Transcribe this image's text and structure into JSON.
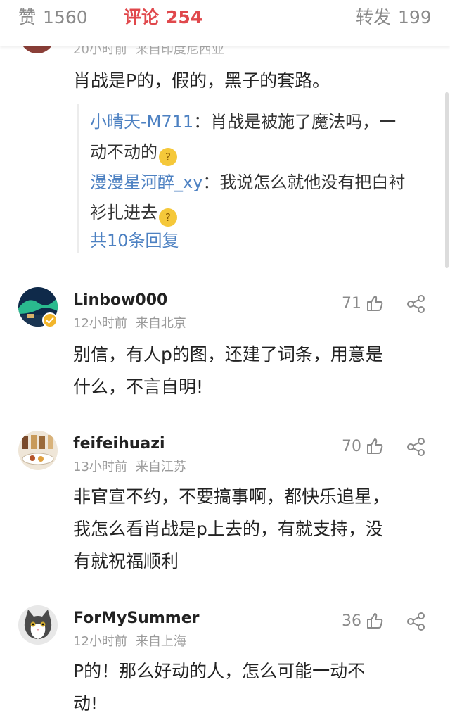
{
  "tabs": {
    "like": {
      "label": "赞",
      "count": "1560"
    },
    "comment": {
      "label": "评论",
      "count": "254"
    },
    "repost": {
      "label": "转发",
      "count": "199"
    }
  },
  "partial_comment": {
    "time": "20小时前",
    "source": "来自印度尼西亚",
    "text": "肖战是P的，假的，黑子的套路。",
    "replies": [
      {
        "user": "小晴天-M711",
        "sep": "：",
        "text_line1": "肖战是被施了魔法吗，一",
        "text_line2": "动不动的",
        "emoji": "thinking-emoji"
      },
      {
        "user": "漫漫星河醉_xy",
        "sep": "：",
        "text_line1": "我说怎么就他没有把白衬",
        "text_line2": "衫扎进去",
        "emoji": "laughing-emoji"
      }
    ],
    "more_replies": "共10条回复"
  },
  "comments": [
    {
      "user": "Linbow000",
      "time": "12小时前",
      "source": "来自北京",
      "likes": "71",
      "line1": "别信，有人p的图，还建了词条，用意是",
      "line2": "什么，不言自明!",
      "line3": ""
    },
    {
      "user": "feifeihuazi",
      "time": "13小时前",
      "source": "来自江苏",
      "likes": "70",
      "line1": "非官宣不约，不要搞事啊，都快乐追星，",
      "line2": "我怎么看肖战是p上去的，有就支持，没",
      "line3": "有就祝福顺利"
    },
    {
      "user": "ForMySummer",
      "time": "12小时前",
      "source": "来自上海",
      "likes": "36",
      "line1": "P的！那么好动的人，怎么可能一动不",
      "line2": "动!",
      "line3": ""
    }
  ],
  "icons": {
    "like": "thumbs-up-icon",
    "share": "share-icon"
  },
  "colors": {
    "accent": "#e0484c",
    "link": "#4d81c2",
    "muted": "#9a9a9a"
  }
}
